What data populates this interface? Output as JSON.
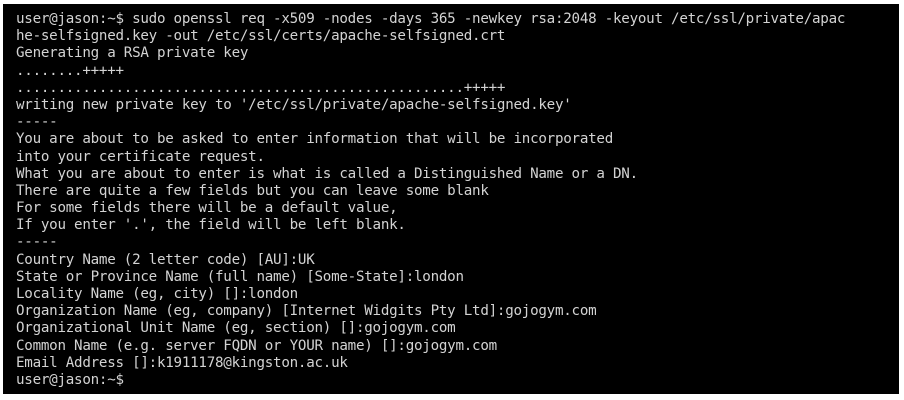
{
  "terminal": {
    "lines": [
      "user@jason:~$ sudo openssl req -x509 -nodes -days 365 -newkey rsa:2048 -keyout /etc/ssl/private/apac",
      "he-selfsigned.key -out /etc/ssl/certs/apache-selfsigned.crt",
      "Generating a RSA private key",
      "........+++++",
      "......................................................+++++",
      "writing new private key to '/etc/ssl/private/apache-selfsigned.key'",
      "-----",
      "You are about to be asked to enter information that will be incorporated",
      "into your certificate request.",
      "What you are about to enter is what is called a Distinguished Name or a DN.",
      "There are quite a few fields but you can leave some blank",
      "For some fields there will be a default value,",
      "If you enter '.', the field will be left blank.",
      "-----",
      "Country Name (2 letter code) [AU]:UK",
      "State or Province Name (full name) [Some-State]:london",
      "Locality Name (eg, city) []:london",
      "Organization Name (eg, company) [Internet Widgits Pty Ltd]:gojogym.com",
      "Organizational Unit Name (eg, section) []:gojogym.com",
      "Common Name (e.g. server FQDN or YOUR name) []:gojogym.com",
      "Email Address []:k1911178@kingston.ac.uk",
      "user@jason:~$"
    ]
  }
}
